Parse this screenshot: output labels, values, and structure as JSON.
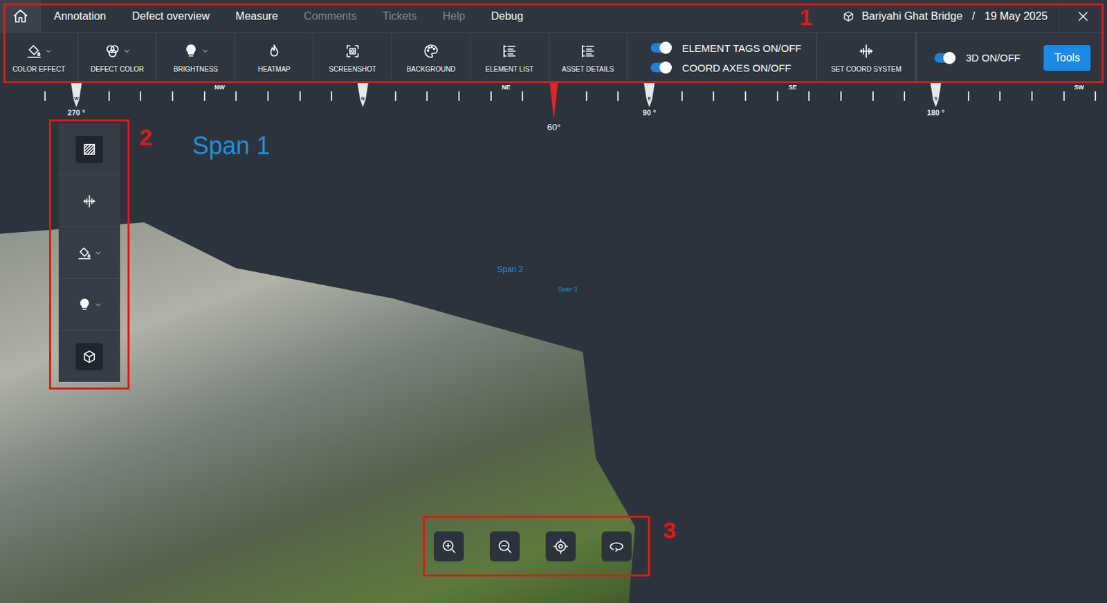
{
  "nav": {
    "tabs": [
      {
        "label": "Annotation",
        "disabled": false
      },
      {
        "label": "Defect overview",
        "disabled": false
      },
      {
        "label": "Measure",
        "disabled": false
      },
      {
        "label": "Comments",
        "disabled": true
      },
      {
        "label": "Tickets",
        "disabled": true
      },
      {
        "label": "Help",
        "disabled": true
      },
      {
        "label": "Debug",
        "disabled": false
      }
    ],
    "project": "Bariyahi Ghat Bridge",
    "separator": "/",
    "date": "19 May 2025"
  },
  "toolbar": {
    "items": [
      {
        "label": "COLOR EFFECT",
        "kind": "fill",
        "dropdown": true
      },
      {
        "label": "DEFECT COLOR",
        "kind": "defect",
        "dropdown": true
      },
      {
        "label": "BRIGHTNESS",
        "kind": "bulb",
        "dropdown": true
      },
      {
        "label": "HEATMAP",
        "kind": "flame",
        "dropdown": false
      },
      {
        "label": "SCREENSHOT",
        "kind": "screenshot",
        "dropdown": false
      },
      {
        "label": "BACKGROUND",
        "kind": "palette",
        "dropdown": false
      },
      {
        "label": "ELEMENT LIST",
        "kind": "list",
        "dropdown": false
      },
      {
        "label": "ASSET DETAILS",
        "kind": "list",
        "dropdown": false
      }
    ],
    "toggles": [
      {
        "label": "ELEMENT TAGS ON/OFF",
        "on": true
      },
      {
        "label": "COORD AXES ON/OFF",
        "on": true
      }
    ],
    "coordSystem": {
      "label": "SET COORD SYSTEM",
      "kind": "axes"
    },
    "toggle3d": {
      "label": "3D ON/OFF",
      "on": true
    },
    "tools": "Tools"
  },
  "compass": {
    "points": [
      {
        "label": "W",
        "kind": "cardinal",
        "reading": "270 °"
      },
      {
        "label": "NW",
        "kind": "intercardinal",
        "reading": ""
      },
      {
        "label": "N",
        "kind": "cardinal",
        "reading": ""
      },
      {
        "label": "NE",
        "kind": "intercardinal",
        "reading": ""
      },
      {
        "label": "E",
        "kind": "cardinal",
        "reading": "90 °"
      },
      {
        "label": "SE",
        "kind": "intercardinal",
        "reading": ""
      },
      {
        "label": "S",
        "kind": "cardinal",
        "reading": "180 °"
      },
      {
        "label": "SW",
        "kind": "intercardinal",
        "reading": ""
      }
    ],
    "heading": "60°"
  },
  "elementTags": [
    {
      "label": "Span 1",
      "size": "large"
    },
    {
      "label": "Span 2",
      "size": "medium"
    },
    {
      "label": "Span 3",
      "size": "small"
    }
  ],
  "sideTools": [
    {
      "kind": "hatch",
      "dropdown": false,
      "selected": true
    },
    {
      "kind": "axes",
      "dropdown": false,
      "selected": false
    },
    {
      "kind": "fill",
      "dropdown": true,
      "selected": false
    },
    {
      "kind": "bulb",
      "dropdown": true,
      "selected": false
    },
    {
      "kind": "cube",
      "dropdown": false,
      "selected": true
    }
  ],
  "viewControls": [
    {
      "kind": "zoom-in"
    },
    {
      "kind": "zoom-out"
    },
    {
      "kind": "target"
    },
    {
      "kind": "rotate"
    }
  ],
  "annotations": [
    {
      "label": "1"
    },
    {
      "label": "2"
    },
    {
      "label": "3"
    }
  ]
}
